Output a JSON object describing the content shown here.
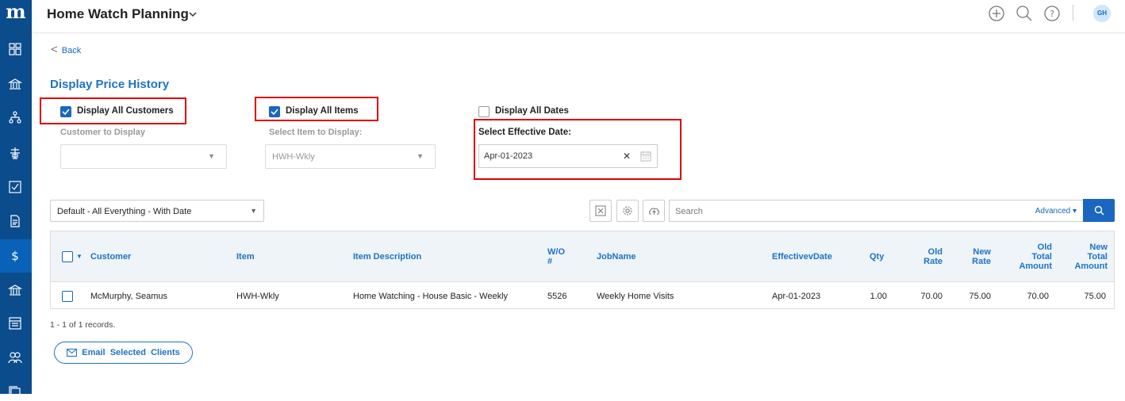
{
  "app": {
    "logo": "m",
    "title": "Home Watch Planning",
    "user_initials": "GH"
  },
  "nav": {
    "back_label": "Back",
    "page_title": "Display Price History"
  },
  "filters": {
    "all_customers": {
      "label": "Display All Customers",
      "checked": true
    },
    "customer_label": "Customer to Display",
    "customer_value": "",
    "all_items": {
      "label": "Display All Items",
      "checked": true
    },
    "item_label": "Select Item to Display:",
    "item_value": "HWH-Wkly",
    "all_dates": {
      "label": "Display All Dates",
      "checked": false
    },
    "date_label": "Select Effective Date:",
    "date_value": "Apr-01-2023",
    "clear_glyph": "✕"
  },
  "toolbar": {
    "view_value": "Default - All Everything - With Date",
    "search_placeholder": "Search",
    "advanced_label": "Advanced ▾"
  },
  "table": {
    "headers": {
      "customer": "Customer",
      "item": "Item",
      "item_description": "Item Description",
      "wo_line1": "W/O",
      "wo_line2": "#",
      "job_name": "JobName",
      "effective_date": "EffectivevDate",
      "qty": "Qty",
      "old_rate_1": "Old",
      "old_rate_2": "Rate",
      "new_rate_1": "New",
      "new_rate_2": "Rate",
      "old_total_1": "Old",
      "old_total_2": "Total",
      "old_total_3": "Amount",
      "new_total_1": "New",
      "new_total_2": "Total",
      "new_total_3": "Amount"
    },
    "rows": [
      {
        "customer": "McMurphy, Seamus",
        "item": "HWH-Wkly",
        "item_description": "Home Watching - House Basic - Weekly",
        "wo": "5526",
        "job_name": "Weekly Home Visits",
        "effective_date": "Apr-01-2023",
        "qty": "1.00",
        "old_rate": "70.00",
        "new_rate": "75.00",
        "old_total": "70.00",
        "new_total": "75.00"
      }
    ]
  },
  "footer": {
    "records": "1 - 1 of 1 records.",
    "email_button": "Email  Selected  Clients"
  },
  "colors": {
    "sidebar": "#0b4c8c",
    "accent": "#1d73c5",
    "highlight": "#e00000"
  }
}
